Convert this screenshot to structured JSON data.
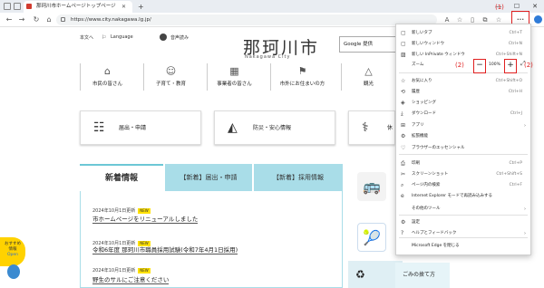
{
  "browser": {
    "tab_title": "那珂川市ホームページトップページ",
    "address": "https://www.city.nakagawa.lg.jp/",
    "window_buttons": [
      "—",
      "☐",
      "✕"
    ]
  },
  "site": {
    "top_links": [
      "本文へ",
      "Language",
      "音声読み"
    ],
    "logo_text": "那珂川市",
    "logo_sub": "Nakagawa City",
    "search_label": "Google 提供",
    "global_nav": [
      "市民の皆さん",
      "子育て・教育",
      "事業者の皆さん",
      "市外にお住まいの方",
      "観光"
    ],
    "categories": [
      "届出・申請",
      "防災・安心情報",
      "休"
    ],
    "news_tabs": [
      "新着情報",
      "【新着】届出・申請",
      "【新着】採用情報"
    ],
    "news_items": [
      {
        "date": "2024年10月1日更新",
        "badge": "NEW",
        "title": "市ホームページをリニューアルしました"
      },
      {
        "date": "2024年10月1日更新",
        "badge": "NEW",
        "title": "令和6年度 那珂川市職員採用試験(令和7年4月1日採用)"
      },
      {
        "date": "2024年10月1日更新",
        "badge": "NEW",
        "title": "野生のサルにご注意ください"
      }
    ],
    "osusume": [
      "おすすめ",
      "情報",
      "Open"
    ],
    "gomi": "ごみの捨て方"
  },
  "menu": {
    "items": [
      {
        "icon": "▢",
        "label": "新しいタブ",
        "shortcut": "Ctrl+T"
      },
      {
        "icon": "▢",
        "label": "新しいウィンドウ",
        "shortcut": "Ctrl+N"
      },
      {
        "icon": "▨",
        "label": "新しい InPrivate ウィンドウ",
        "shortcut": "Ctrl+Shift+N"
      },
      {
        "icon": "☆",
        "label": "お気に入り",
        "shortcut": "Ctrl+Shift+O"
      },
      {
        "icon": "⟲",
        "label": "履歴",
        "shortcut": "Ctrl+H"
      },
      {
        "icon": "◈",
        "label": "ショッピング",
        "shortcut": ""
      },
      {
        "icon": "⤓",
        "label": "ダウンロード",
        "shortcut": "Ctrl+J"
      },
      {
        "icon": "⊞",
        "label": "アプリ",
        "shortcut": ""
      },
      {
        "icon": "⚙",
        "label": "拡張機能",
        "shortcut": ""
      },
      {
        "icon": "♡",
        "label": "ブラウザーのエッセンシャル",
        "shortcut": ""
      },
      {
        "icon": "⎙",
        "label": "印刷",
        "shortcut": "Ctrl+P"
      },
      {
        "icon": "✂",
        "label": "スクリーンショット",
        "shortcut": "Ctrl+Shift+S"
      },
      {
        "icon": "⌕",
        "label": "ページ内の検索",
        "shortcut": "Ctrl+F"
      },
      {
        "icon": "e",
        "label": "Internet Explorer モードで再読み込みする",
        "shortcut": ""
      },
      {
        "icon": "",
        "label": "その他のツール",
        "shortcut": ""
      },
      {
        "icon": "⚙",
        "label": "設定",
        "shortcut": ""
      },
      {
        "icon": "?",
        "label": "ヘルプとフィードバック",
        "shortcut": ""
      },
      {
        "icon": "",
        "label": "Microsoft Edge を閉じる",
        "shortcut": ""
      }
    ],
    "zoom_label": "ズーム",
    "zoom_value": "100%",
    "zoom_minus": "−",
    "zoom_plus": "+"
  },
  "annotations": {
    "more": "(1)",
    "minus": "(2)",
    "plus": "(2)",
    "more_button": "···"
  },
  "colors": {
    "accent": "#e01f1f",
    "news_tab": "#a9dde8",
    "badge": "#ffe100"
  }
}
